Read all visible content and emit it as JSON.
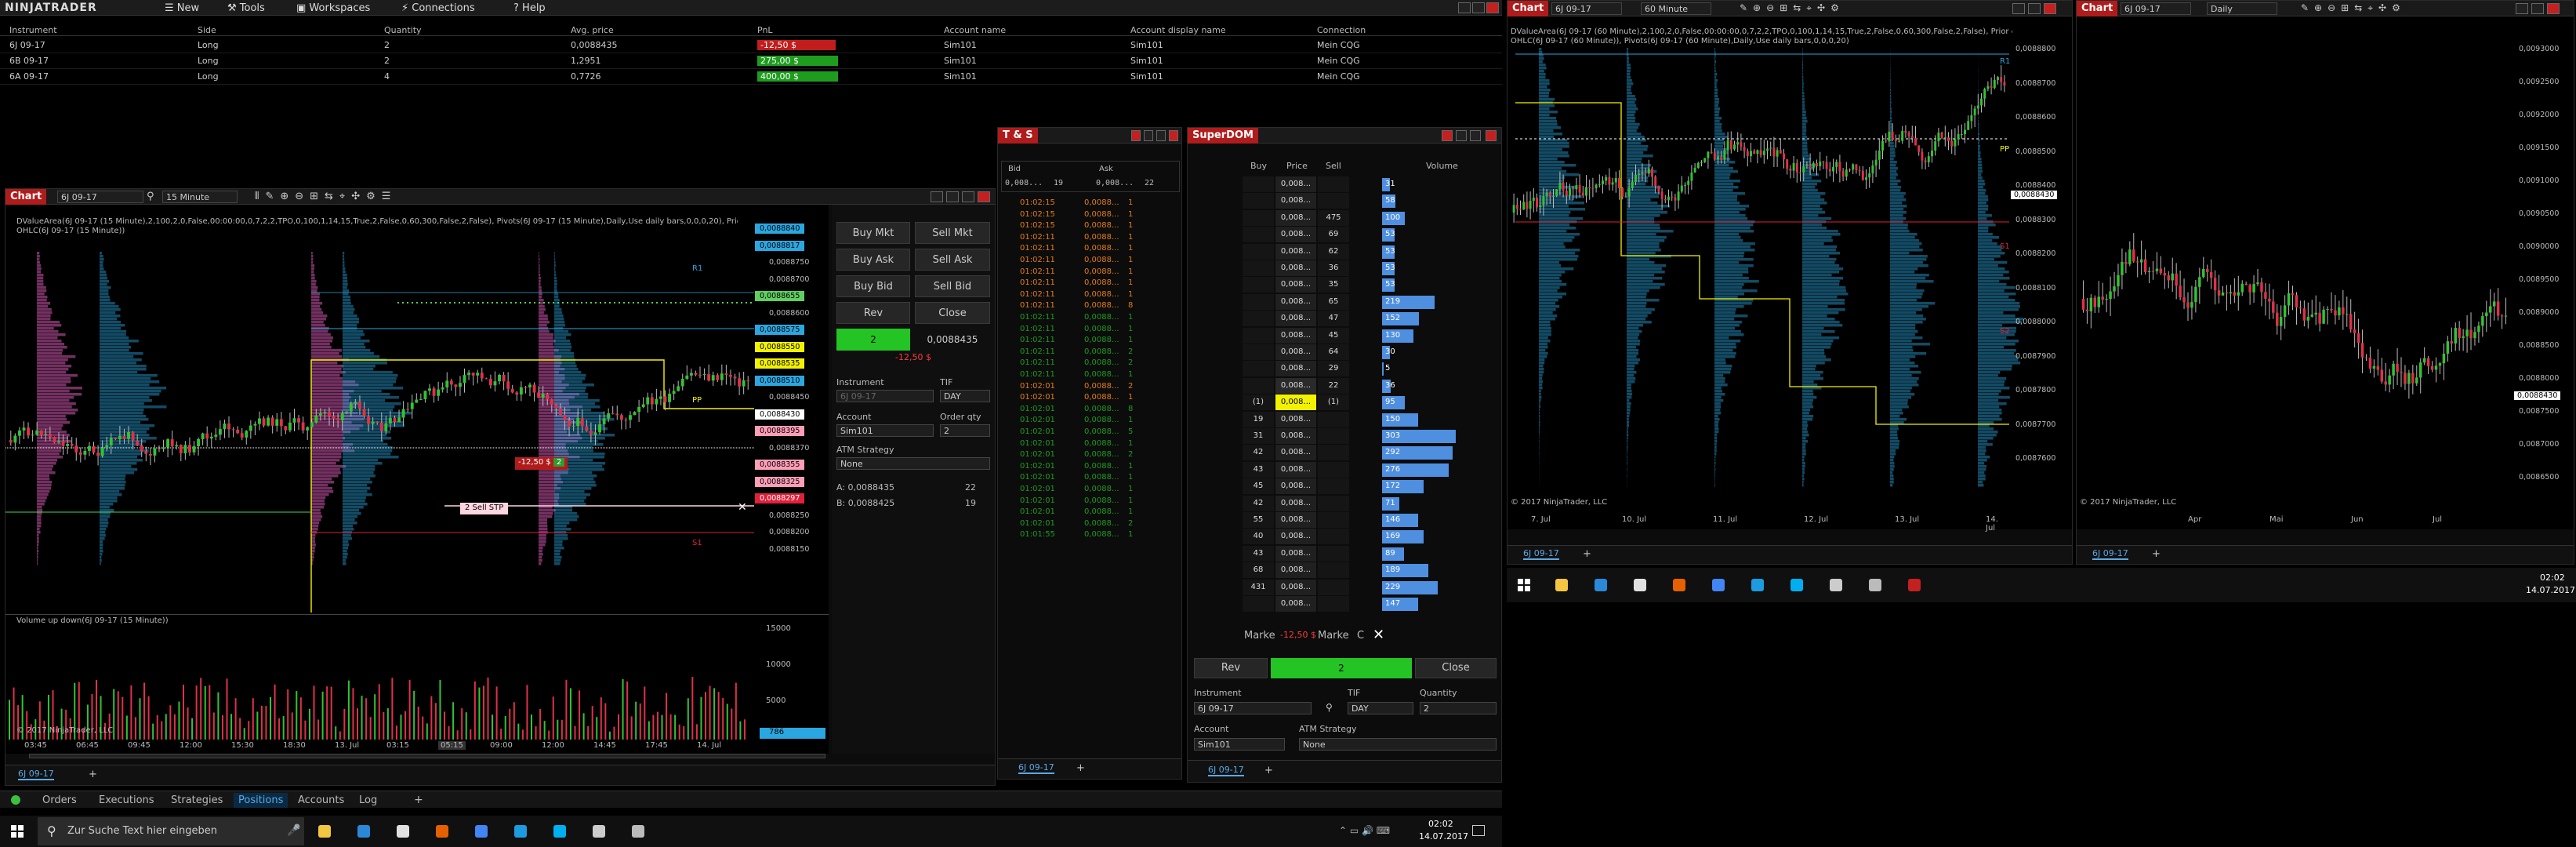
{
  "app": {
    "logo": "NINJATRADER",
    "menu": [
      "New",
      "Tools",
      "Workspaces",
      "Connections",
      "Help"
    ]
  },
  "positions": {
    "headers": [
      "Instrument",
      "Side",
      "Quantity",
      "Avg. price",
      "PnL",
      "Account name",
      "Account display name",
      "Connection"
    ],
    "rows": [
      {
        "instrument": "6J 09-17",
        "side": "Long",
        "qty": "2",
        "avg": "0,0088435",
        "pnl": "-12,50 $",
        "pnl_color": "#c21d1d",
        "account": "Sim101",
        "display": "Sim101",
        "conn": "Mein CQG"
      },
      {
        "instrument": "6B 09-17",
        "side": "Long",
        "qty": "2",
        "avg": "1,2951",
        "pnl": "275,00 $",
        "pnl_color": "#1e9c1e",
        "account": "Sim101",
        "display": "Sim101",
        "conn": "Mein CQG"
      },
      {
        "instrument": "6A 09-17",
        "side": "Long",
        "qty": "4",
        "avg": "0,7726",
        "pnl": "400,00 $",
        "pnl_color": "#1e9c1e",
        "account": "Sim101",
        "display": "Sim101",
        "conn": "Mein CQG"
      }
    ]
  },
  "chart1": {
    "tag": "Chart",
    "instrument": "6J 09-17",
    "interval": "15 Minute",
    "indicator_line1": "DValueArea(6J 09-17 (15 Minute),2,100,2,0,False,00:00:00,0,7,2,2,TPO,0,100,1,14,15,True,2,False,0,60,300,False,2,False), Pivots(6J 09-17 (15 Minute),Daily,Use daily bars,0,0,0,20), Prior day",
    "indicator_line2": "OHLC(6J 09-17 (15 Minute))",
    "price_labels": [
      {
        "text": "0,0088840",
        "color": "#2aa7e0",
        "txt": "#000"
      },
      {
        "text": "0,0088817",
        "color": "#2aa7e0",
        "txt": "#000"
      },
      {
        "text": "0,0088750",
        "color": null,
        "txt": "#bbb"
      },
      {
        "text": "0,0088700",
        "color": null,
        "txt": "#bbb"
      },
      {
        "text": "0,0088655",
        "color": "#5fcf5f",
        "txt": "#000"
      },
      {
        "text": "0,0088600",
        "color": null,
        "txt": "#bbb"
      },
      {
        "text": "0,0088575",
        "color": "#2aa7e0",
        "txt": "#000"
      },
      {
        "text": "0,0088550",
        "color": "#f2f200",
        "txt": "#000"
      },
      {
        "text": "0,0088535",
        "color": "#f2f200",
        "txt": "#000"
      },
      {
        "text": "0,0088510",
        "color": "#2aa7e0",
        "txt": "#000"
      },
      {
        "text": "0,0088450",
        "color": null,
        "txt": "#bbb"
      },
      {
        "text": "0,0088430",
        "color": "#ffffff",
        "txt": "#000"
      },
      {
        "text": "0,0088395",
        "color": "#ff9db6",
        "txt": "#000"
      },
      {
        "text": "0,0088370",
        "color": null,
        "txt": "#bbb"
      },
      {
        "text": "0,0088355",
        "color": "#ff9db6",
        "txt": "#000"
      },
      {
        "text": "0,0088325",
        "color": "#ff9db6",
        "txt": "#000"
      },
      {
        "text": "0,0088297",
        "color": "#e0213b",
        "txt": "#fff"
      },
      {
        "text": "0,0088250",
        "color": null,
        "txt": "#bbb"
      },
      {
        "text": "0,0088200",
        "color": null,
        "txt": "#bbb"
      },
      {
        "text": "0,0088150",
        "color": null,
        "txt": "#bbb"
      }
    ],
    "volume_title": "Volume up down(6J 09-17 (15 Minute))",
    "volume_ticks": [
      "15000",
      "10000",
      "5000"
    ],
    "volume_last": "786",
    "copyright": "© 2017 NinjaTrader, LLC",
    "time_axis": [
      "03:45",
      "06:45",
      "09:45",
      "12:00",
      "15:30",
      "18:30",
      "13. Jul",
      "03:15",
      "05:15",
      "09:00",
      "12:00",
      "14:45",
      "17:45",
      "14. Jul"
    ],
    "order_label": "-12,50 $",
    "order_qty": "2",
    "stop_label": "2  Sell STP",
    "tab": "6J 09-17",
    "pivots": [
      "R1",
      "PP",
      "S1"
    ]
  },
  "chart_trader": {
    "buttons": [
      "Buy Mkt",
      "Sell Mkt",
      "Buy Ask",
      "Sell Ask",
      "Buy Bid",
      "Sell Bid",
      "Rev",
      "Close"
    ],
    "position_qty": "2",
    "position_price": "0,0088435",
    "position_pnl": "-12,50 $",
    "instrument_label": "Instrument",
    "tif_label": "TIF",
    "instrument": "6J 09-17",
    "tif": "DAY",
    "account_label": "Account",
    "order_qty_label": "Order qty",
    "account": "Sim101",
    "order_qty": "2",
    "atm_label": "ATM Strategy",
    "atm": "None",
    "ask": "A:  0,0088435",
    "ask_size": "22",
    "bid": "B:  0,0088425",
    "bid_size": "19"
  },
  "ts": {
    "tag": "T & S",
    "headers": [
      "Bid",
      "Ask"
    ],
    "bid": "0,008...",
    "bid_size": "19",
    "ask": "0,008...",
    "ask_size": "22",
    "tab": "6J 09-17",
    "rows": [
      {
        "t": "01:02:15",
        "p": "0,0088...",
        "s": "1",
        "c": "#e37c16"
      },
      {
        "t": "01:02:15",
        "p": "0,0088...",
        "s": "1",
        "c": "#e37c16"
      },
      {
        "t": "01:02:15",
        "p": "0,0088...",
        "s": "1",
        "c": "#e37c16"
      },
      {
        "t": "01:02:11",
        "p": "0,0088...",
        "s": "1",
        "c": "#e37c16"
      },
      {
        "t": "01:02:11",
        "p": "0,0088...",
        "s": "1",
        "c": "#e37c16"
      },
      {
        "t": "01:02:11",
        "p": "0,0088...",
        "s": "1",
        "c": "#e37c16"
      },
      {
        "t": "01:02:11",
        "p": "0,0088...",
        "s": "1",
        "c": "#e37c16"
      },
      {
        "t": "01:02:11",
        "p": "0,0088...",
        "s": "1",
        "c": "#e37c16"
      },
      {
        "t": "01:02:11",
        "p": "0,0088...",
        "s": "1",
        "c": "#e37c16"
      },
      {
        "t": "01:02:11",
        "p": "0,0088...",
        "s": "8",
        "c": "#e37c16"
      },
      {
        "t": "01:02:11",
        "p": "0,0088...",
        "s": "1",
        "c": "#1e9c1e"
      },
      {
        "t": "01:02:11",
        "p": "0,0088...",
        "s": "1",
        "c": "#1e9c1e"
      },
      {
        "t": "01:02:11",
        "p": "0,0088...",
        "s": "1",
        "c": "#1e9c1e"
      },
      {
        "t": "01:02:11",
        "p": "0,0088...",
        "s": "2",
        "c": "#1e9c1e"
      },
      {
        "t": "01:02:11",
        "p": "0,0088...",
        "s": "2",
        "c": "#1e9c1e"
      },
      {
        "t": "01:02:11",
        "p": "0,0088...",
        "s": "1",
        "c": "#1e9c1e"
      },
      {
        "t": "01:02:01",
        "p": "0,0088...",
        "s": "2",
        "c": "#e37c16"
      },
      {
        "t": "01:02:01",
        "p": "0,0088...",
        "s": "1",
        "c": "#e37c16"
      },
      {
        "t": "01:02:01",
        "p": "0,0088...",
        "s": "8",
        "c": "#1e9c1e"
      },
      {
        "t": "01:02:01",
        "p": "0,0088...",
        "s": "1",
        "c": "#1e9c1e"
      },
      {
        "t": "01:02:01",
        "p": "0,0088...",
        "s": "5",
        "c": "#1e9c1e"
      },
      {
        "t": "01:02:01",
        "p": "0,0088...",
        "s": "1",
        "c": "#1e9c1e"
      },
      {
        "t": "01:02:01",
        "p": "0,0088...",
        "s": "2",
        "c": "#1e9c1e"
      },
      {
        "t": "01:02:01",
        "p": "0,0088...",
        "s": "1",
        "c": "#1e9c1e"
      },
      {
        "t": "01:02:01",
        "p": "0,0088...",
        "s": "1",
        "c": "#1e9c1e"
      },
      {
        "t": "01:02:01",
        "p": "0,0088...",
        "s": "1",
        "c": "#1e9c1e"
      },
      {
        "t": "01:02:01",
        "p": "0,0088...",
        "s": "1",
        "c": "#1e9c1e"
      },
      {
        "t": "01:02:01",
        "p": "0,0088...",
        "s": "1",
        "c": "#1e9c1e"
      },
      {
        "t": "01:02:01",
        "p": "0,0088...",
        "s": "2",
        "c": "#1e9c1e"
      },
      {
        "t": "01:01:55",
        "p": "0,0088...",
        "s": "1",
        "c": "#1e9c1e"
      }
    ]
  },
  "dom": {
    "tag": "SuperDOM",
    "headers": [
      "Buy",
      "Price",
      "Sell",
      "Volume"
    ],
    "rows": [
      {
        "buy": "",
        "price": "0,008...",
        "sell": "",
        "vol": "31",
        "vw": 8,
        "hl": ""
      },
      {
        "buy": "",
        "price": "0,008...",
        "sell": "",
        "vol": "58",
        "vw": 14,
        "hl": ""
      },
      {
        "buy": "",
        "price": "0,008...",
        "sell": "475",
        "vol": "100",
        "vw": 24,
        "hl": ""
      },
      {
        "buy": "",
        "price": "0,008...",
        "sell": "69",
        "vol": "53",
        "vw": 13,
        "hl": ""
      },
      {
        "buy": "",
        "price": "0,008...",
        "sell": "62",
        "vol": "53",
        "vw": 13,
        "hl": ""
      },
      {
        "buy": "",
        "price": "0,008...",
        "sell": "36",
        "vol": "53",
        "vw": 13,
        "hl": ""
      },
      {
        "buy": "",
        "price": "0,008...",
        "sell": "35",
        "vol": "53",
        "vw": 13,
        "hl": ""
      },
      {
        "buy": "",
        "price": "0,008...",
        "sell": "65",
        "vol": "219",
        "vw": 56,
        "hl": ""
      },
      {
        "buy": "",
        "price": "0,008...",
        "sell": "47",
        "vol": "152",
        "vw": 39,
        "hl": ""
      },
      {
        "buy": "",
        "price": "0,008...",
        "sell": "45",
        "vol": "130",
        "vw": 33,
        "hl": ""
      },
      {
        "buy": "",
        "price": "0,008...",
        "sell": "64",
        "vol": "30",
        "vw": 8,
        "hl": ""
      },
      {
        "buy": "",
        "price": "0,008...",
        "sell": "29",
        "vol": "5",
        "vw": 2,
        "hl": ""
      },
      {
        "buy": "",
        "price": "0,008...",
        "sell": "22",
        "vol": "36",
        "vw": 9,
        "hl": "ask"
      },
      {
        "buy": "(1)",
        "price": "0,008...",
        "sell": "(1)",
        "vol": "95",
        "vw": 24,
        "hl": "last"
      },
      {
        "buy": "19",
        "price": "0,008...",
        "sell": "",
        "vol": "150",
        "vw": 38,
        "hl": ""
      },
      {
        "buy": "31",
        "price": "0,008...",
        "sell": "",
        "vol": "303",
        "vw": 78,
        "hl": ""
      },
      {
        "buy": "42",
        "price": "0,008...",
        "sell": "",
        "vol": "292",
        "vw": 75,
        "hl": ""
      },
      {
        "buy": "43",
        "price": "0,008...",
        "sell": "",
        "vol": "276",
        "vw": 71,
        "hl": ""
      },
      {
        "buy": "45",
        "price": "0,008...",
        "sell": "",
        "vol": "172",
        "vw": 44,
        "hl": ""
      },
      {
        "buy": "42",
        "price": "0,008...",
        "sell": "",
        "vol": "71",
        "vw": 18,
        "hl": ""
      },
      {
        "buy": "55",
        "price": "0,008...",
        "sell": "",
        "vol": "146",
        "vw": 38,
        "hl": ""
      },
      {
        "buy": "40",
        "price": "0,008...",
        "sell": "",
        "vol": "169",
        "vw": 44,
        "hl": ""
      },
      {
        "buy": "43",
        "price": "0,008...",
        "sell": "",
        "vol": "89",
        "vw": 23,
        "hl": ""
      },
      {
        "buy": "68",
        "price": "0,008...",
        "sell": "",
        "vol": "189",
        "vw": 49,
        "hl": ""
      },
      {
        "buy": "431",
        "price": "0,008...",
        "sell": "",
        "vol": "229",
        "vw": 59,
        "hl": ""
      },
      {
        "buy": "",
        "price": "0,008...",
        "sell": "",
        "vol": "147",
        "vw": 38,
        "hl": ""
      }
    ],
    "mkt_left": "Marke",
    "pnl": "-12,50 $",
    "mkt_right": "Marke",
    "c_label": "C",
    "rev": "Rev",
    "position": "2",
    "close": "Close",
    "instrument_label": "Instrument",
    "tif_label": "TIF",
    "qty_label": "Quantity",
    "instrument": "6J 09-17",
    "tif": "DAY",
    "qty": "2",
    "account_label": "Account",
    "atm_label": "ATM Strategy",
    "account": "Sim101",
    "atm": "None",
    "tab": "6J 09-17"
  },
  "chart2": {
    "tag": "Chart",
    "instrument": "6J 09-17",
    "interval": "60 Minute",
    "indicator_line1": "DValueArea(6J 09-17 (60 Minute),2,100,2,0,False,00:00:00,0,7,2,2,TPO,0,100,1,14,15,True,2,False,0,60,300,False,2,False), Prior day",
    "indicator_line2": "OHLC(6J 09-17 (60 Minute)), Pivots(6J 09-17 (60 Minute),Daily,Use daily bars,0,0,0,20)",
    "price_ticks": [
      "0,0088800",
      "0,0088700",
      "0,0088600",
      "0,0088500",
      "0,0088400",
      "0,0088300",
      "0,0088200",
      "0,0088100",
      "0,0088000",
      "0,0087900",
      "0,0087800",
      "0,0087700",
      "0,0087600"
    ],
    "last": "0,0088430",
    "time_axis": [
      "7. Jul",
      "10. Jul",
      "11. Jul",
      "12. Jul",
      "13. Jul",
      "14. Jul"
    ],
    "copyright": "© 2017 NinjaTrader, LLC",
    "tab": "6J 09-17",
    "pivots": [
      "R1",
      "PP",
      "S1",
      "S2"
    ]
  },
  "chart3": {
    "tag": "Chart",
    "instrument": "6J 09-17",
    "interval": "Daily",
    "price_ticks": [
      "0,0093000",
      "0,0092500",
      "0,0092000",
      "0,0091500",
      "0,0091000",
      "0,0090500",
      "0,0090000",
      "0,0089500",
      "0,0089000",
      "0,0088500",
      "0,0088000",
      "0,0087500",
      "0,0087000",
      "0,0086500"
    ],
    "last": "0,0088430",
    "time_axis": [
      "Apr",
      "Mai",
      "Jun",
      "Jul"
    ],
    "copyright": "© 2017 NinjaTrader, LLC",
    "tab": "6J 09-17"
  },
  "bottom_tabs": [
    "Orders",
    "Executions",
    "Strategies",
    "Positions",
    "Accounts",
    "Log"
  ],
  "taskbar1": {
    "search": "Zur Suche Text hier eingeben",
    "time": "02:02",
    "date": "14.07.2017"
  },
  "taskbar2": {
    "time": "02:02",
    "date": "14.07.2017"
  },
  "icons": [
    "windows-icon",
    "search-icon",
    "task-view-icon",
    "edge-icon",
    "explorer-icon",
    "store-icon",
    "firefox-icon",
    "chrome-icon",
    "skype-icon",
    "calculator-icon",
    "ninjatrader-icon"
  ]
}
